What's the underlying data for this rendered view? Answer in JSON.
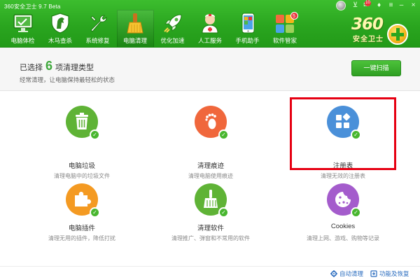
{
  "app": {
    "title": "360安全卫士 9.7 Beta"
  },
  "window_controls": {
    "mail_badge": "10"
  },
  "nav": {
    "items": [
      {
        "label": "电脑体检",
        "icon": "monitor-check-icon"
      },
      {
        "label": "木马查杀",
        "icon": "horse-shield-icon"
      },
      {
        "label": "系统修复",
        "icon": "wrench-icon"
      },
      {
        "label": "电脑清理",
        "icon": "broom-icon",
        "active": true
      },
      {
        "label": "优化加速",
        "icon": "rocket-icon"
      },
      {
        "label": "人工服务",
        "icon": "doctor-icon"
      },
      {
        "label": "手机助手",
        "icon": "phone-icon"
      },
      {
        "label": "软件管家",
        "icon": "software-grid-icon",
        "badge": "5"
      }
    ]
  },
  "brand": {
    "number": "360",
    "name": "安全卫士"
  },
  "summary": {
    "prefix": "已选择",
    "count": "6",
    "suffix": "项清理类型",
    "description": "经常清理，让电脑保持最轻松的状态",
    "scan_button": "一键扫描"
  },
  "cards": [
    {
      "title": "电脑垃圾",
      "desc": "清理电脑中的垃圾文件",
      "icon": "trash-icon",
      "color": "#5fb336",
      "checked": true
    },
    {
      "title": "清理痕迹",
      "desc": "清理电脑使用痕迹",
      "icon": "footprint-icon",
      "color": "#f0673c",
      "checked": true
    },
    {
      "title": "注册表",
      "desc": "清理无效的注册表",
      "icon": "registry-blocks-icon",
      "color": "#4a90d9",
      "checked": true
    },
    {
      "title": "电脑插件",
      "desc": "清理无用的插件，降低打扰",
      "icon": "puzzle-icon",
      "color": "#f49a22",
      "checked": true
    },
    {
      "title": "清理软件",
      "desc": "清理推广、弹窗和不常用的软件",
      "icon": "broom-icon",
      "color": "#5fb336",
      "checked": true
    },
    {
      "title": "Cookies",
      "desc": "清理上网、游戏、购物等记录",
      "icon": "cookie-icon",
      "color": "#a45ccc",
      "checked": true
    }
  ],
  "footer": {
    "auto_clean": "自动清理",
    "restore": "功能及恢复"
  },
  "colors": {
    "header_green": "#2aa51f",
    "accent_green": "#3fa83c",
    "highlight_red": "#e60012",
    "link_blue": "#2a6cbf"
  }
}
